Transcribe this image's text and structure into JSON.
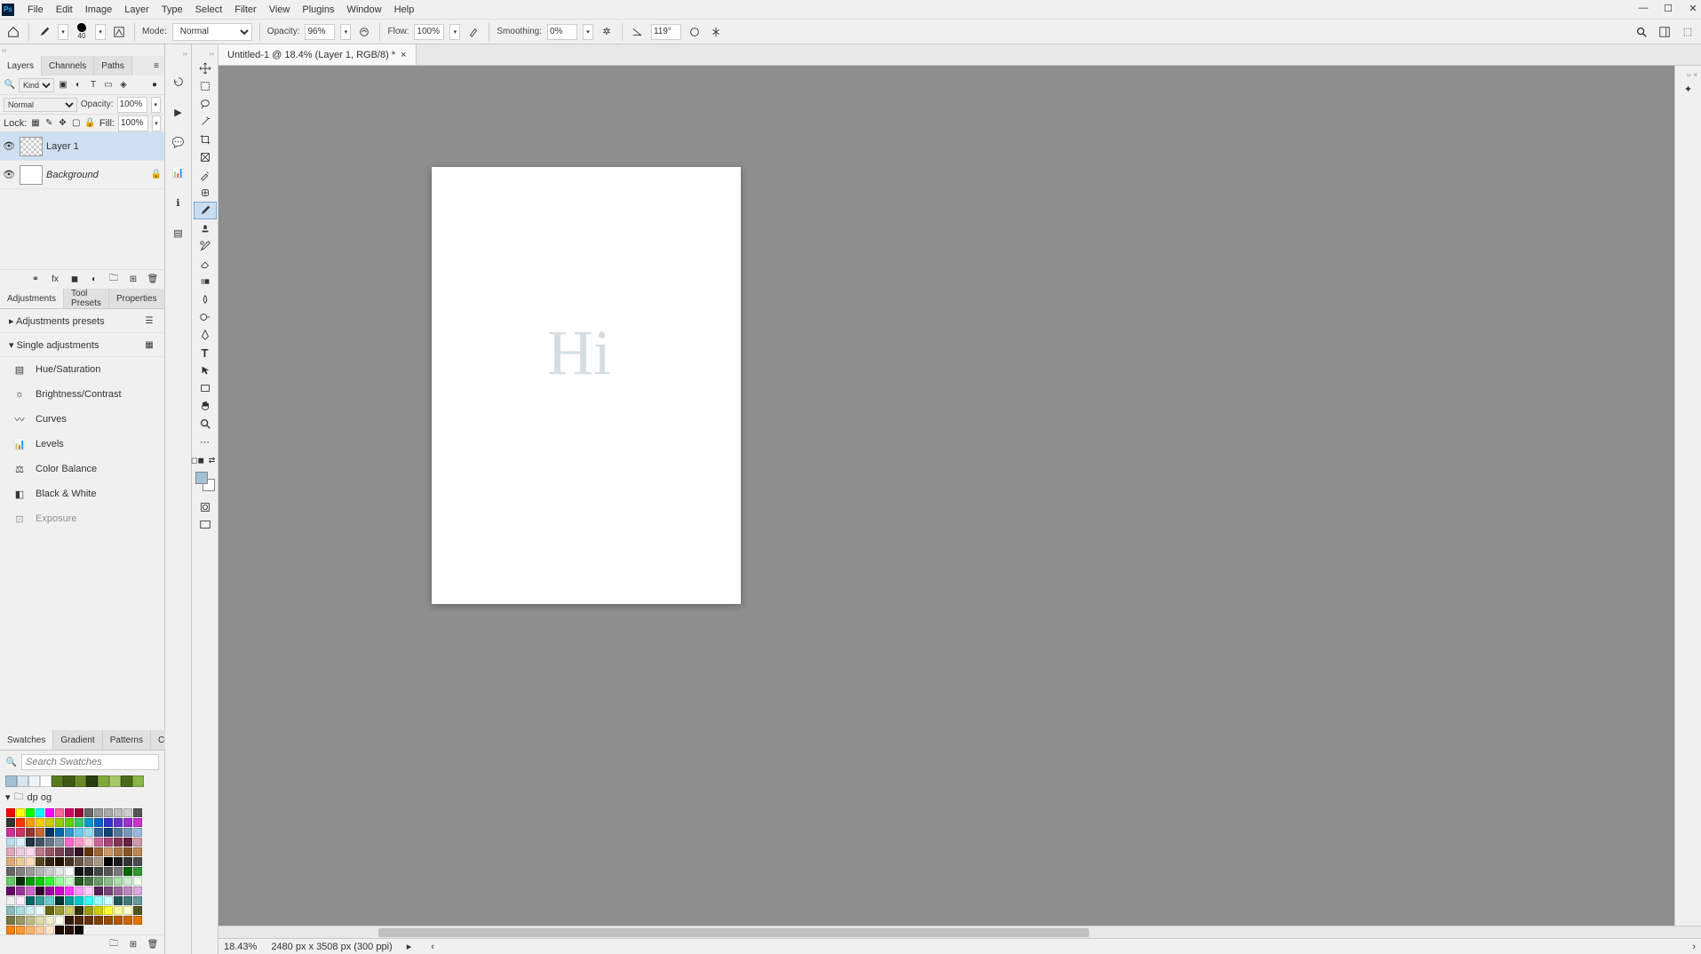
{
  "menu": {
    "items": [
      "File",
      "Edit",
      "Image",
      "Layer",
      "Type",
      "Select",
      "Filter",
      "View",
      "Plugins",
      "Window",
      "Help"
    ]
  },
  "optionsBar": {
    "brushSize": "40",
    "modeLabel": "Mode:",
    "mode": "Normal",
    "opacityLabel": "Opacity:",
    "opacity": "96%",
    "flowLabel": "Flow:",
    "flow": "100%",
    "smoothingLabel": "Smoothing:",
    "smoothing": "0%",
    "angle": "119°"
  },
  "docTab": {
    "title": "Untitled-1 @ 18.4% (Layer 1, RGB/8) *"
  },
  "panels": {
    "layers": {
      "tabs": [
        "Layers",
        "Channels",
        "Paths"
      ],
      "kind": "Kind",
      "blend": "Normal",
      "opacityLabel": "Opacity:",
      "opacity": "100%",
      "lockLabel": "Lock:",
      "fillLabel": "Fill:",
      "fill": "100%",
      "items": [
        {
          "name": "Layer 1",
          "selected": true,
          "locked": false
        },
        {
          "name": "Background",
          "selected": false,
          "locked": true
        }
      ]
    },
    "adjustments": {
      "tabs": [
        "Adjustments",
        "Tool Presets",
        "Properties"
      ],
      "presetsHeader": "Adjustments presets",
      "singleHeader": "Single adjustments",
      "items": [
        "Hue/Saturation",
        "Brightness/Contrast",
        "Curves",
        "Levels",
        "Color Balance",
        "Black & White",
        "Exposure"
      ]
    },
    "swatches": {
      "tabs": [
        "Swatches",
        "Gradient",
        "Patterns",
        "Color"
      ],
      "searchPlaceholder": "Search Swatches",
      "folder": "dp og"
    }
  },
  "status": {
    "zoom": "18.43%",
    "dims": "2480 px x 3508 px (300 ppi)"
  },
  "canvas": {
    "text": "Hi"
  },
  "swatchRow": [
    "#a3c2d6",
    "#d8e6ef",
    "#eef5f9",
    "#ffffff",
    "#5a7a1f",
    "#3f5a15",
    "#6a8a2a",
    "#2a3d0e",
    "#7fa83a",
    "#a8c96a",
    "#4a6a1a",
    "#8ab547"
  ],
  "swatchGrid": [
    "#ff0000",
    "#ffff00",
    "#00ff00",
    "#00ffff",
    "#ff00ff",
    "#ff6699",
    "#cc0066",
    "#990033",
    "#666666",
    "#999999",
    "#aaaaaa",
    "#bbbbbb",
    "#cccccc",
    "#555555",
    "#333333",
    "#ff3300",
    "#ff9900",
    "#ffcc00",
    "#cccc00",
    "#99cc00",
    "#66cc00",
    "#33cc66",
    "#0099cc",
    "#0066cc",
    "#3333cc",
    "#6633cc",
    "#9933cc",
    "#cc33cc",
    "#cc3399",
    "#cc3366",
    "#993333",
    "#cc6633",
    "#003366",
    "#0066aa",
    "#3399cc",
    "#66ccee",
    "#99ddee",
    "#336699",
    "#114477",
    "#557799",
    "#7799bb",
    "#99bbdd",
    "#bbddee",
    "#ddf0ff",
    "#223344",
    "#445566",
    "#667788",
    "#8899aa",
    "#ff66cc",
    "#ff99cc",
    "#ffccdd",
    "#cc6699",
    "#aa4477",
    "#883355",
    "#662244",
    "#cc99aa",
    "#ddaabb",
    "#eeccdd",
    "#ffddee",
    "#bb7788",
    "#995566",
    "#774455",
    "#553344",
    "#331122",
    "#663300",
    "#996633",
    "#cc9966",
    "#aa7744",
    "#885522",
    "#bb8855",
    "#ddaa77",
    "#eecc99",
    "#ffddbb",
    "#554422",
    "#332211",
    "#221100",
    "#443322",
    "#665544",
    "#887766",
    "#aa9988",
    "#000000",
    "#1a1a1a",
    "#333333",
    "#4d4d4d",
    "#666666",
    "#808080",
    "#999999",
    "#b3b3b3",
    "#cccccc",
    "#e6e6e6",
    "#ffffff",
    "#111111",
    "#222222",
    "#444444",
    "#555555",
    "#777777",
    "#006600",
    "#339933",
    "#66cc66",
    "#003300",
    "#009900",
    "#00cc00",
    "#33ff33",
    "#99ff99",
    "#ccffcc",
    "#225522",
    "#447744",
    "#669966",
    "#88bb88",
    "#aaddaa",
    "#cceecc",
    "#eeffee",
    "#660066",
    "#993399",
    "#cc66cc",
    "#330033",
    "#990099",
    "#cc00cc",
    "#ff33ff",
    "#ff99ff",
    "#ffccff",
    "#552255",
    "#774477",
    "#996699",
    "#bb88bb",
    "#ddaadd",
    "#eecc ee",
    "#ffeeff",
    "#006666",
    "#339999",
    "#66cccc",
    "#003333",
    "#009999",
    "#00cccc",
    "#33ffff",
    "#99ffff",
    "#ccffff",
    "#225555",
    "#447777",
    "#669999",
    "#88bbbb",
    "#aadddd",
    "#cceeee",
    "#eeffff",
    "#666600",
    "#999933",
    "#cccc66",
    "#333300",
    "#999900",
    "#cccc00",
    "#ffff33",
    "#ffff99",
    "#ffffcc",
    "#555522",
    "#777744",
    "#999966",
    "#bbbb88",
    "#ddddaa",
    "#eeeecc",
    "#ffffee",
    "#331a00",
    "#4d2600",
    "#663300",
    "#804000",
    "#994d00",
    "#b35900",
    "#cc6600",
    "#e67300",
    "#ff8000",
    "#ff9933",
    "#ffb366",
    "#ffcc99",
    "#ffe6cc",
    "#1a0d00",
    "#261300",
    "#0d0600"
  ]
}
